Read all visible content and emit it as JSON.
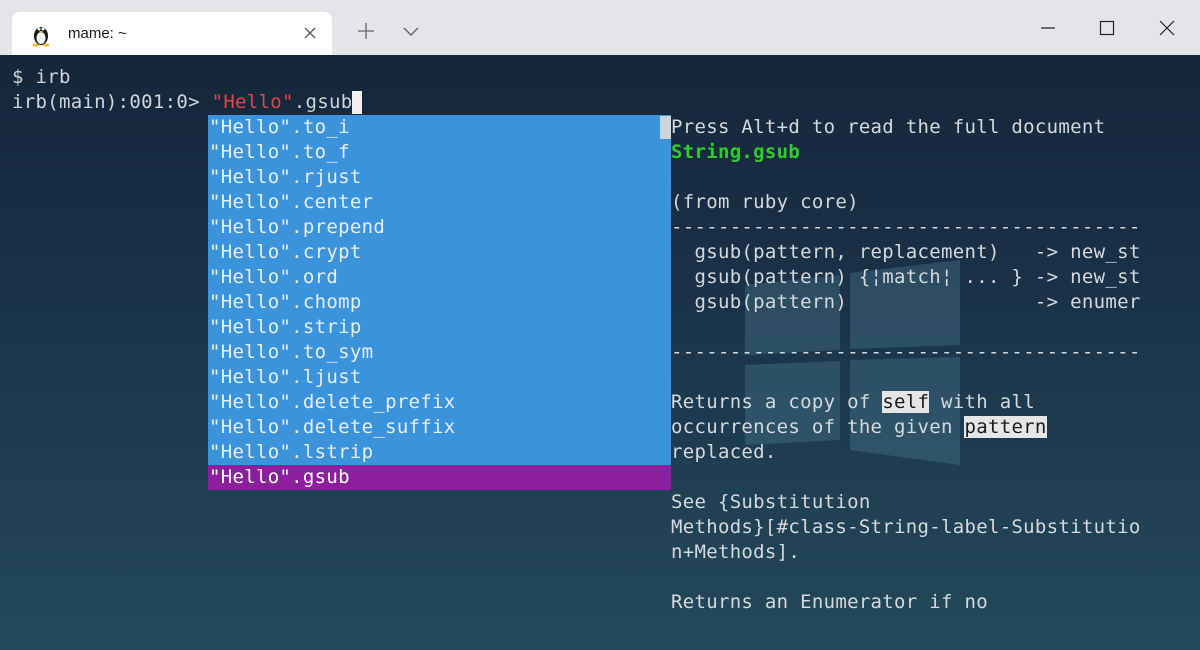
{
  "window": {
    "tab_title": "mame: ~",
    "tab_icon": "linux-tux-icon",
    "new_tab_icon": "plus-icon",
    "dropdown_icon": "chevron-down-icon",
    "minimize_icon": "minimize-icon",
    "maximize_icon": "maximize-icon",
    "close_icon": "close-icon"
  },
  "terminal": {
    "line1": "$ irb",
    "prompt": "irb(main):001:0> ",
    "input_quote_open": "\"",
    "input_string": "Hello",
    "input_quote_close": "\"",
    "input_method": ".gsub"
  },
  "completion": {
    "items": [
      "\"Hello\".to_i",
      "\"Hello\".to_f",
      "\"Hello\".rjust",
      "\"Hello\".center",
      "\"Hello\".prepend",
      "\"Hello\".crypt",
      "\"Hello\".ord",
      "\"Hello\".chomp",
      "\"Hello\".strip",
      "\"Hello\".to_sym",
      "\"Hello\".ljust",
      "\"Hello\".delete_prefix",
      "\"Hello\".delete_suffix",
      "\"Hello\".lstrip",
      "\"Hello\".gsub"
    ],
    "selected_index": 14,
    "colors": {
      "list_bg": "#3b93dc",
      "selected_bg": "#8c1f9e"
    }
  },
  "doc": {
    "hint": "Press Alt+d to read the full document",
    "title": "String.gsub",
    "source": "(from ruby core)",
    "rule": "----------------------------------------",
    "sig1": "  gsub(pattern, replacement)   -> new_st",
    "sig2": "  gsub(pattern) {¦match¦ ... } -> new_st",
    "sig3": "  gsub(pattern)                -> enumer",
    "desc1_pre": "Returns a copy of ",
    "desc1_hl": "self",
    "desc1_post": " with all",
    "desc2_pre": "occurrences of the given ",
    "desc2_hl": "pattern",
    "desc3": "replaced.",
    "see1": "See {Substitution",
    "see2": "Methods}[#class-String-label-Substitutio",
    "see3": "n+Methods].",
    "returns": "Returns an Enumerator if no",
    "colors": {
      "title": "#2ecc2e",
      "highlight_bg": "#e6e6e6"
    }
  }
}
